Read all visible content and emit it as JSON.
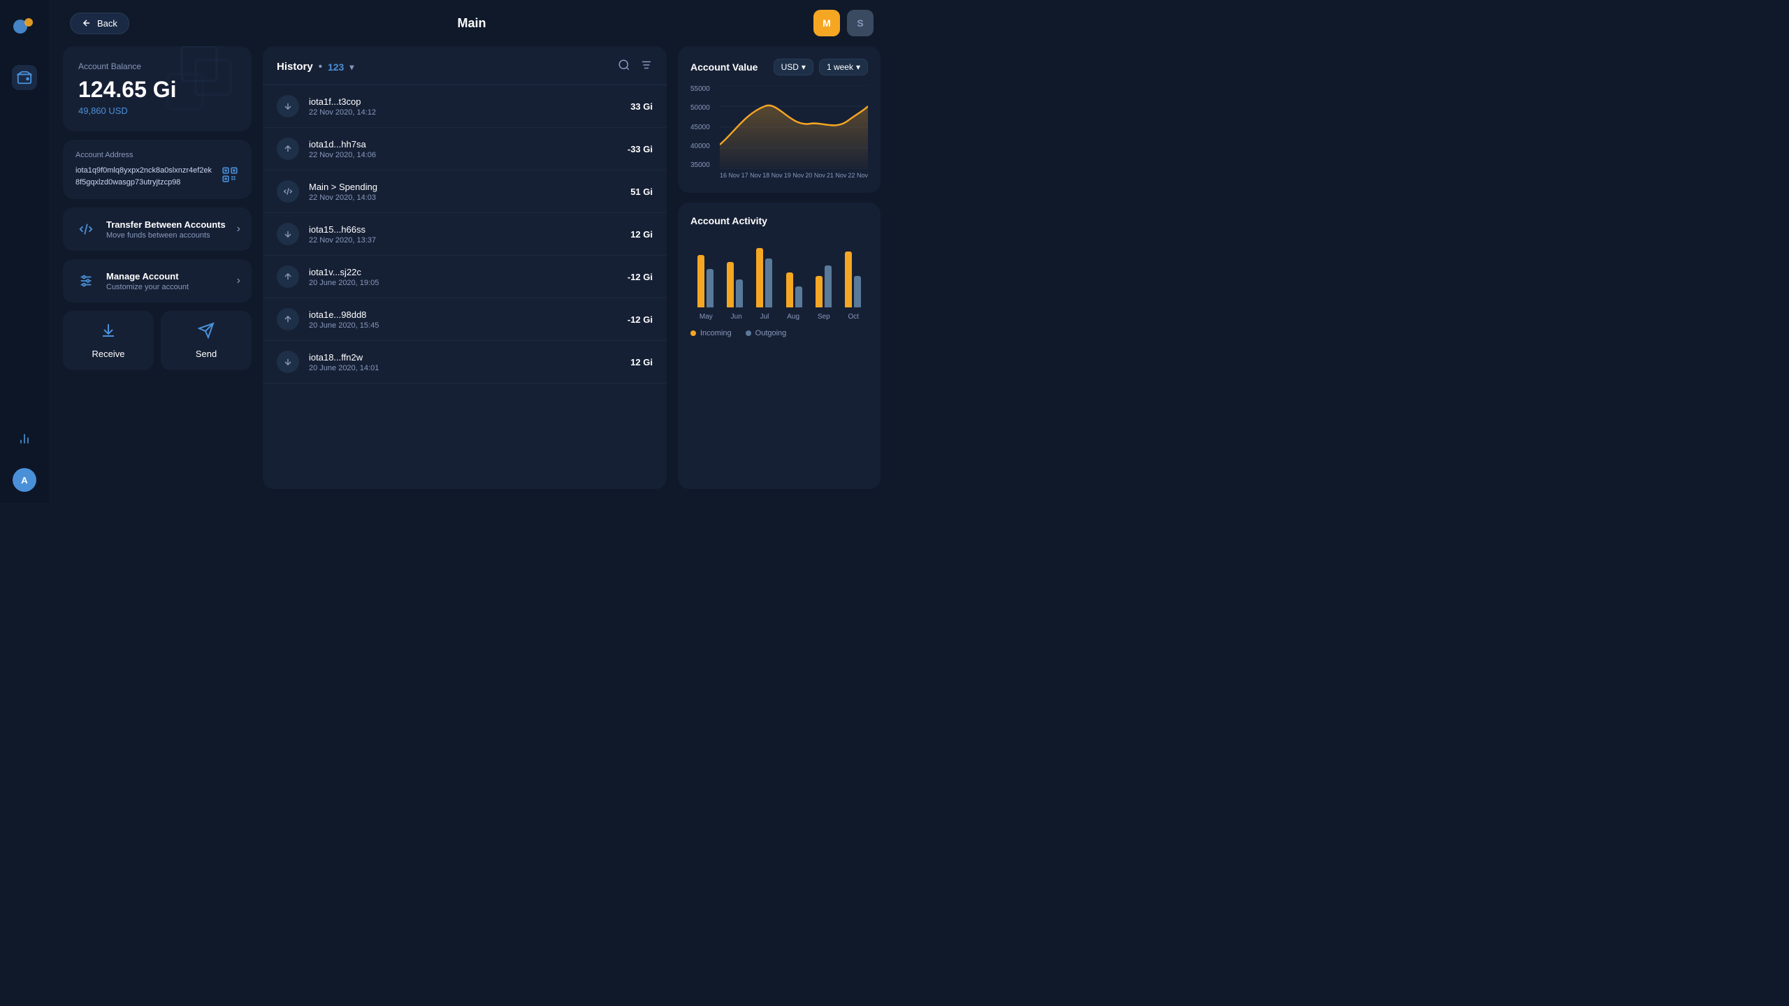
{
  "sidebar": {
    "logo_alt": "App logo",
    "items": [
      {
        "name": "wallet",
        "icon": "⊡",
        "active": true
      },
      {
        "name": "chart",
        "icon": "▐",
        "active": false
      }
    ],
    "bottom_avatar": {
      "label": "A",
      "color": "#4a90d9"
    }
  },
  "header": {
    "back_label": "Back",
    "title": "Main",
    "avatar_m": {
      "label": "M",
      "color": "#f5a623"
    },
    "avatar_s": {
      "label": "S",
      "color": "#5a7a9a"
    }
  },
  "left": {
    "balance_label": "Account Balance",
    "balance_amount": "124.65 Gi",
    "balance_usd": "49,860 USD",
    "address_label": "Account Address",
    "address_text": "iota1q9f0mlq8yxpx2nck8a0slxnzr4ef2ek8f5gqxlzd0wasgp73utryjtzcp98",
    "transfer_title": "Transfer Between Accounts",
    "transfer_subtitle": "Move funds between accounts",
    "manage_title": "Manage Account",
    "manage_subtitle": "Customize your account",
    "receive_label": "Receive",
    "send_label": "Send"
  },
  "history": {
    "title": "History",
    "count": "123",
    "transactions": [
      {
        "address": "iota1f...t3cop",
        "date": "22 Nov 2020, 14:12",
        "amount": "33 Gi",
        "type": "incoming"
      },
      {
        "address": "iota1d...hh7sa",
        "date": "22 Nov 2020, 14:06",
        "amount": "-33 Gi",
        "type": "outgoing"
      },
      {
        "address": "Main > Spending",
        "date": "22 Nov 2020, 14:03",
        "amount": "51 Gi",
        "type": "transfer"
      },
      {
        "address": "iota15...h66ss",
        "date": "22 Nov 2020, 13:37",
        "amount": "12 Gi",
        "type": "incoming"
      },
      {
        "address": "iota1v...sj22c",
        "date": "20 June 2020, 19:05",
        "amount": "-12 Gi",
        "type": "outgoing"
      },
      {
        "address": "iota1e...98dd8",
        "date": "20 June 2020, 15:45",
        "amount": "-12 Gi",
        "type": "outgoing"
      },
      {
        "address": "iota18...ffn2w",
        "date": "20 June 2020, 14:01",
        "amount": "12 Gi",
        "type": "incoming"
      }
    ]
  },
  "chart": {
    "title": "Account Value",
    "currency": "USD",
    "period": "1 week",
    "y_labels": [
      "55000",
      "50000",
      "45000",
      "40000",
      "35000"
    ],
    "x_labels": [
      "16 Nov",
      "17 Nov",
      "18 Nov",
      "19 Nov",
      "20 Nov",
      "21 Nov",
      "22 Nov"
    ]
  },
  "activity": {
    "title": "Account Activity",
    "x_labels": [
      "May",
      "Jun",
      "Jul",
      "Aug",
      "Sep",
      "Oct"
    ],
    "bars": [
      {
        "incoming": 75,
        "outgoing": 55
      },
      {
        "incoming": 65,
        "outgoing": 40
      },
      {
        "incoming": 85,
        "outgoing": 70
      },
      {
        "incoming": 50,
        "outgoing": 30
      },
      {
        "incoming": 45,
        "outgoing": 60
      },
      {
        "incoming": 80,
        "outgoing": 45
      }
    ],
    "legend_incoming": "Incoming",
    "legend_outgoing": "Outgoing"
  }
}
